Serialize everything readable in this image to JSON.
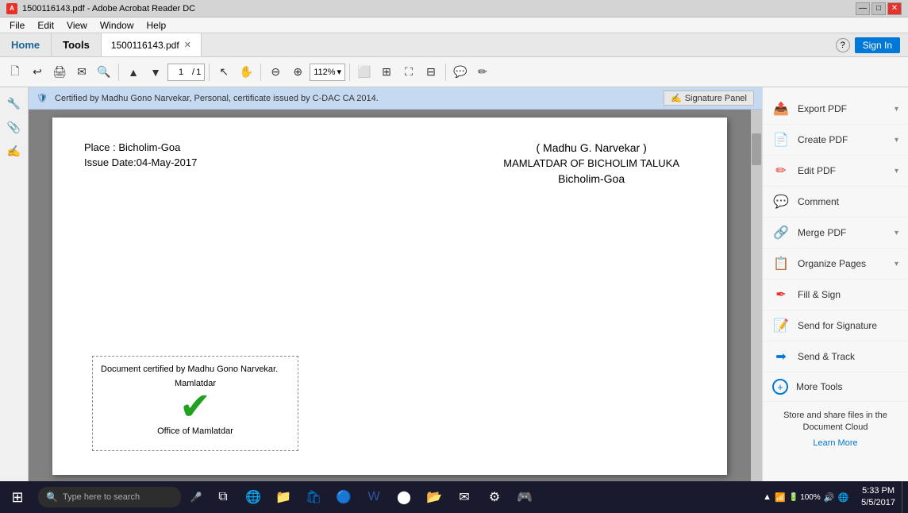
{
  "titleBar": {
    "title": "1500116143.pdf - Adobe Acrobat Reader DC",
    "controls": [
      "—",
      "□",
      "✕"
    ]
  },
  "menuBar": {
    "items": [
      "File",
      "Edit",
      "View",
      "Window",
      "Help"
    ]
  },
  "tabs": {
    "home": "Home",
    "tools": "Tools",
    "document": "1500116143.pdf",
    "helpIcon": "?",
    "signIn": "Sign In"
  },
  "toolbar": {
    "pageNum": "1",
    "pageTotal": "1",
    "zoom": "112%"
  },
  "certBanner": {
    "text": "Certified by Madhu Gono Narvekar, Personal, certificate issued by C-DAC CA 2014.",
    "sigPanel": "Signature Panel"
  },
  "pdfContent": {
    "place": "Place : Bicholim-Goa",
    "issueDate": "Issue Date:04-May-2017",
    "signerName": "( Madhu G. Narvekar )",
    "designation": "MAMLATDAR OF BICHOLIM TALUKA",
    "city": "Bicholim-Goa",
    "stampText": "Document certified by Madhu Gono Narvekar.",
    "stampLine1": "Mamlatdar",
    "stampLine2": "Office of Mamlatdar"
  },
  "rightPanel": {
    "items": [
      {
        "id": "export-pdf",
        "label": "Export PDF",
        "icon": "📤",
        "expandable": true
      },
      {
        "id": "create-pdf",
        "label": "Create PDF",
        "icon": "📄",
        "expandable": true
      },
      {
        "id": "edit-pdf",
        "label": "Edit PDF",
        "icon": "✏️",
        "expandable": true
      },
      {
        "id": "comment",
        "label": "Comment",
        "icon": "💬",
        "expandable": false
      },
      {
        "id": "merge-pdf",
        "label": "Merge PDF",
        "icon": "🔗",
        "expandable": true
      },
      {
        "id": "organize-pages",
        "label": "Organize Pages",
        "icon": "📋",
        "expandable": true
      },
      {
        "id": "fill-sign",
        "label": "Fill & Sign",
        "icon": "✒️",
        "expandable": false
      },
      {
        "id": "send-signature",
        "label": "Send for Signature",
        "icon": "📝",
        "expandable": false
      },
      {
        "id": "send-track",
        "label": "Send & Track",
        "icon": "➡️",
        "expandable": false
      },
      {
        "id": "more-tools",
        "label": "More Tools",
        "icon": "➕",
        "expandable": false
      }
    ],
    "storeText": "Store and share files in the Document Cloud",
    "learnMore": "Learn More"
  },
  "taskbar": {
    "searchPlaceholder": "Type here to search",
    "time": "5:33 PM",
    "date": "5/5/2017",
    "battery": "100%"
  }
}
